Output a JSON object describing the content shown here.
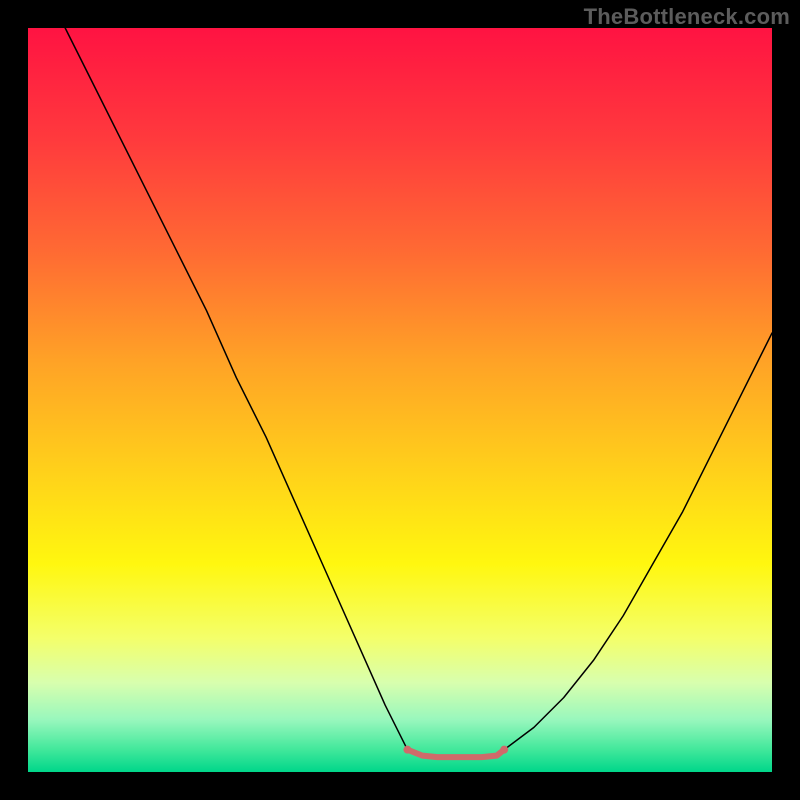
{
  "watermark": "TheBottleneck.com",
  "chart_data": {
    "type": "line",
    "title": "",
    "xlabel": "",
    "ylabel": "",
    "xlim": [
      0,
      100
    ],
    "ylim": [
      0,
      100
    ],
    "grid": false,
    "legend": false,
    "background_gradient": {
      "stops": [
        {
          "offset": 0.0,
          "color": "#ff1342"
        },
        {
          "offset": 0.15,
          "color": "#ff3a3d"
        },
        {
          "offset": 0.3,
          "color": "#ff6a33"
        },
        {
          "offset": 0.45,
          "color": "#ffa326"
        },
        {
          "offset": 0.6,
          "color": "#ffd21a"
        },
        {
          "offset": 0.72,
          "color": "#fff70f"
        },
        {
          "offset": 0.82,
          "color": "#f4ff6a"
        },
        {
          "offset": 0.88,
          "color": "#d8ffae"
        },
        {
          "offset": 0.93,
          "color": "#98f7bd"
        },
        {
          "offset": 0.97,
          "color": "#41e89b"
        },
        {
          "offset": 1.0,
          "color": "#00d68a"
        }
      ]
    },
    "series": [
      {
        "name": "left-curve",
        "color": "#000000",
        "width": 1.5,
        "x": [
          5,
          8,
          12,
          16,
          20,
          24,
          28,
          32,
          36,
          40,
          44,
          48,
          51
        ],
        "y": [
          100,
          94,
          86,
          78,
          70,
          62,
          53,
          45,
          36,
          27,
          18,
          9,
          3
        ]
      },
      {
        "name": "right-curve",
        "color": "#000000",
        "width": 1.5,
        "x": [
          64,
          68,
          72,
          76,
          80,
          84,
          88,
          92,
          96,
          100
        ],
        "y": [
          3,
          6,
          10,
          15,
          21,
          28,
          35,
          43,
          51,
          59
        ]
      },
      {
        "name": "bottom-segment",
        "color": "#cf6a6a",
        "width": 6,
        "x": [
          51,
          53,
          55,
          57,
          59,
          61,
          63,
          64
        ],
        "y": [
          3,
          2.2,
          2,
          2,
          2,
          2,
          2.2,
          3
        ]
      }
    ],
    "endpoint_dots": [
      {
        "x": 51,
        "y": 3,
        "r": 4,
        "color": "#cf6a6a"
      },
      {
        "x": 64,
        "y": 3,
        "r": 4,
        "color": "#cf6a6a"
      }
    ]
  }
}
